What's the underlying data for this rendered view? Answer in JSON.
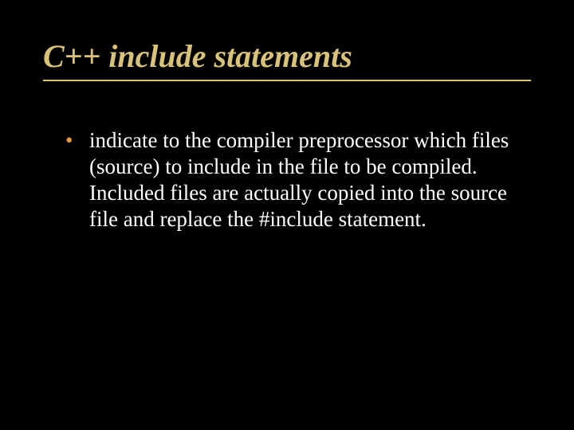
{
  "slide": {
    "title": "C++ include statements",
    "bullets": [
      "indicate to the compiler preprocessor which files (source) to include in the file to be compiled. Included files are actually copied into the source file and replace the #include statement."
    ]
  }
}
